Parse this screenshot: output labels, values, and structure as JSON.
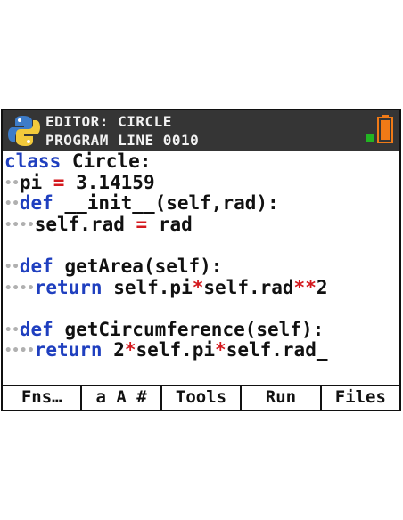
{
  "header": {
    "line1": "EDITOR: CIRCLE",
    "line2": "PROGRAM LINE 0010"
  },
  "icons": {
    "app": "python-logo-icon",
    "status": "status-indicator-icon",
    "battery": "battery-icon"
  },
  "colors": {
    "header_bg": "#353535",
    "keyword": "#1f3fbf",
    "operator": "#d4191e",
    "indent_dots": "#b0b0b0",
    "battery": "#f07a16",
    "status_dot": "#22b522"
  },
  "code": {
    "lines": [
      [
        {
          "t": "kw",
          "v": "class"
        },
        {
          "t": "tx",
          "v": " Circle:"
        }
      ],
      [
        {
          "t": "dots",
          "v": "••"
        },
        {
          "t": "tx",
          "v": "pi "
        },
        {
          "t": "op",
          "v": "="
        },
        {
          "t": "tx",
          "v": " 3.14159"
        }
      ],
      [
        {
          "t": "dots",
          "v": "••"
        },
        {
          "t": "kw",
          "v": "def"
        },
        {
          "t": "tx",
          "v": " __init__(self,rad):"
        }
      ],
      [
        {
          "t": "dots",
          "v": "••••"
        },
        {
          "t": "tx",
          "v": "self.rad "
        },
        {
          "t": "op",
          "v": "="
        },
        {
          "t": "tx",
          "v": " rad"
        }
      ],
      [],
      [
        {
          "t": "dots",
          "v": "••"
        },
        {
          "t": "kw",
          "v": "def"
        },
        {
          "t": "tx",
          "v": " getArea(self):"
        }
      ],
      [
        {
          "t": "dots",
          "v": "••••"
        },
        {
          "t": "kw",
          "v": "return"
        },
        {
          "t": "tx",
          "v": " self.pi"
        },
        {
          "t": "op",
          "v": "*"
        },
        {
          "t": "tx",
          "v": "self.rad"
        },
        {
          "t": "op",
          "v": "**"
        },
        {
          "t": "tx",
          "v": "2"
        }
      ],
      [],
      [
        {
          "t": "dots",
          "v": "••"
        },
        {
          "t": "kw",
          "v": "def"
        },
        {
          "t": "tx",
          "v": " getCircumference(self):"
        }
      ],
      [
        {
          "t": "dots",
          "v": "••••"
        },
        {
          "t": "kw",
          "v": "return"
        },
        {
          "t": "tx",
          "v": " 2"
        },
        {
          "t": "op",
          "v": "*"
        },
        {
          "t": "tx",
          "v": "self.pi"
        },
        {
          "t": "op",
          "v": "*"
        },
        {
          "t": "tx",
          "v": "self.rad"
        },
        {
          "t": "cursor",
          "v": "_"
        }
      ]
    ]
  },
  "menu": {
    "items": [
      "Fns…",
      "a A #",
      "Tools",
      "Run",
      "Files"
    ]
  }
}
